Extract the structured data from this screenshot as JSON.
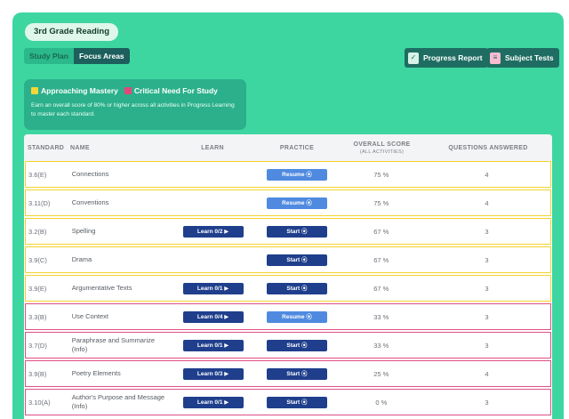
{
  "header": {
    "subject_chip": "3rd Grade Reading",
    "tabs": [
      {
        "label": "Study Plan",
        "active": false
      },
      {
        "label": "Focus Areas",
        "active": true
      }
    ],
    "progress_report_label": "Progress Report",
    "subject_tests_label": "Subject Tests"
  },
  "legend": {
    "approaching_label": "Approaching Mastery",
    "critical_label": "Critical Need For Study",
    "note": "Earn an overall score of 80% or higher across all activities in Progress Learning to master each standard."
  },
  "table": {
    "headers": {
      "standard": "STANDARD",
      "name": "NAME",
      "learn": "LEARN",
      "practice": "PRACTICE",
      "score": "OVERALL SCORE",
      "score_sub": "(ALL ACTIVITIES)",
      "questions": "QUESTIONS ANSWERED"
    },
    "rows": [
      {
        "standard": "3.6(E)",
        "name": "Connections",
        "learn": "",
        "practice": "Resume ⦿",
        "practice_kind": "resume",
        "score": "75 %",
        "questions": "4",
        "status": "yellow"
      },
      {
        "standard": "3.11(D)",
        "name": "Conventions",
        "learn": "",
        "practice": "Resume ⦿",
        "practice_kind": "resume",
        "score": "75 %",
        "questions": "4",
        "status": "yellow"
      },
      {
        "standard": "3.2(B)",
        "name": "Spelling",
        "learn": "Learn 0/2 ▶",
        "practice": "Start ⦿",
        "practice_kind": "start",
        "score": "67 %",
        "questions": "3",
        "status": "yellow"
      },
      {
        "standard": "3.9(C)",
        "name": "Drama",
        "learn": "",
        "practice": "Start ⦿",
        "practice_kind": "start",
        "score": "67 %",
        "questions": "3",
        "status": "yellow"
      },
      {
        "standard": "3.9(E)",
        "name": "Argumentative Texts",
        "learn": "Learn 0/1 ▶",
        "practice": "Start ⦿",
        "practice_kind": "start",
        "score": "67 %",
        "questions": "3",
        "status": "yellow"
      },
      {
        "standard": "3.3(B)",
        "name": "Use Context",
        "learn": "Learn 0/4 ▶",
        "practice": "Resume ⦿",
        "practice_kind": "resume",
        "score": "33 %",
        "questions": "3",
        "status": "pink"
      },
      {
        "standard": "3.7(D)",
        "name": "Paraphrase and Summarize (Info)",
        "learn": "Learn 0/1 ▶",
        "practice": "Start ⦿",
        "practice_kind": "start",
        "score": "33 %",
        "questions": "3",
        "status": "pink"
      },
      {
        "standard": "3.9(B)",
        "name": "Poetry Elements",
        "learn": "Learn 0/3 ▶",
        "practice": "Start ⦿",
        "practice_kind": "start",
        "score": "25 %",
        "questions": "4",
        "status": "pink"
      },
      {
        "standard": "3.10(A)",
        "name": "Author's Purpose and Message (Info)",
        "learn": "Learn 0/1 ▶",
        "practice": "Start ⦿",
        "practice_kind": "start",
        "score": "0 %",
        "questions": "3",
        "status": "pink"
      }
    ]
  },
  "colors": {
    "background": "#3dd6a1",
    "approaching": "#f4d22e",
    "critical": "#df4f85",
    "button_dark": "#1f3f8c",
    "button_light": "#4f8ae0"
  }
}
